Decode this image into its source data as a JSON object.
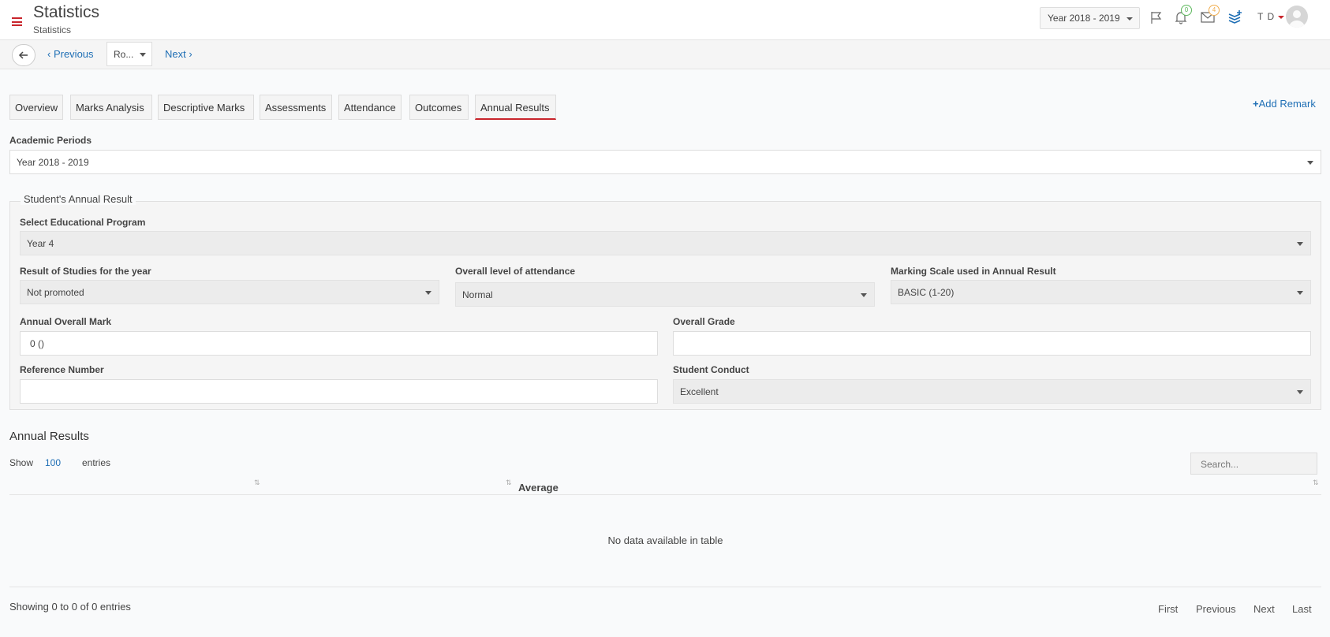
{
  "header": {
    "title": "Statistics",
    "subtitle": "Statistics",
    "year_selector": "Year 2018 - 2019",
    "notifications_count": "0",
    "messages_count": "4",
    "user_initials": "T D"
  },
  "toolbar": {
    "previous_label": "Previous",
    "record_select": "Ro...",
    "next_label": "Next"
  },
  "tabs": [
    {
      "label": "Overview"
    },
    {
      "label": "Marks Analysis"
    },
    {
      "label": "Descriptive Marks"
    },
    {
      "label": "Assessments"
    },
    {
      "label": "Attendance"
    },
    {
      "label": "Outcomes"
    },
    {
      "label": "Annual Results"
    }
  ],
  "active_tab": "Annual Results",
  "add_remark_label": "Add Remark",
  "academic_periods": {
    "label": "Academic Periods",
    "value": "Year 2018 - 2019"
  },
  "annual_result": {
    "legend": "Student's Annual Result",
    "program": {
      "label": "Select Educational Program",
      "value": "Year 4"
    },
    "result_of_studies": {
      "label": "Result of Studies for the year",
      "value": "Not promoted"
    },
    "attendance_level": {
      "label": "Overall level of attendance",
      "value": "Normal"
    },
    "marking_scale": {
      "label": "Marking Scale used in Annual Result",
      "value": "BASIC (1-20)"
    },
    "overall_mark": {
      "label": "Annual Overall Mark",
      "value": "0 ()"
    },
    "overall_grade": {
      "label": "Overall Grade",
      "value": ""
    },
    "reference_number": {
      "label": "Reference Number",
      "value": ""
    },
    "student_conduct": {
      "label": "Student Conduct",
      "value": "Excellent"
    }
  },
  "results_table": {
    "title": "Annual Results",
    "show_label": "Show",
    "entries_value": "100",
    "entries_label": "entries",
    "search_placeholder": "Search...",
    "columns": [
      "",
      "Average"
    ],
    "empty_message": "No data available in table",
    "info": "Showing 0 to 0 of 0 entries",
    "pagination": [
      "First",
      "Previous",
      "Next",
      "Last"
    ]
  },
  "colors": {
    "brand_red": "#c9252c",
    "link_blue": "#1f6fb5"
  }
}
